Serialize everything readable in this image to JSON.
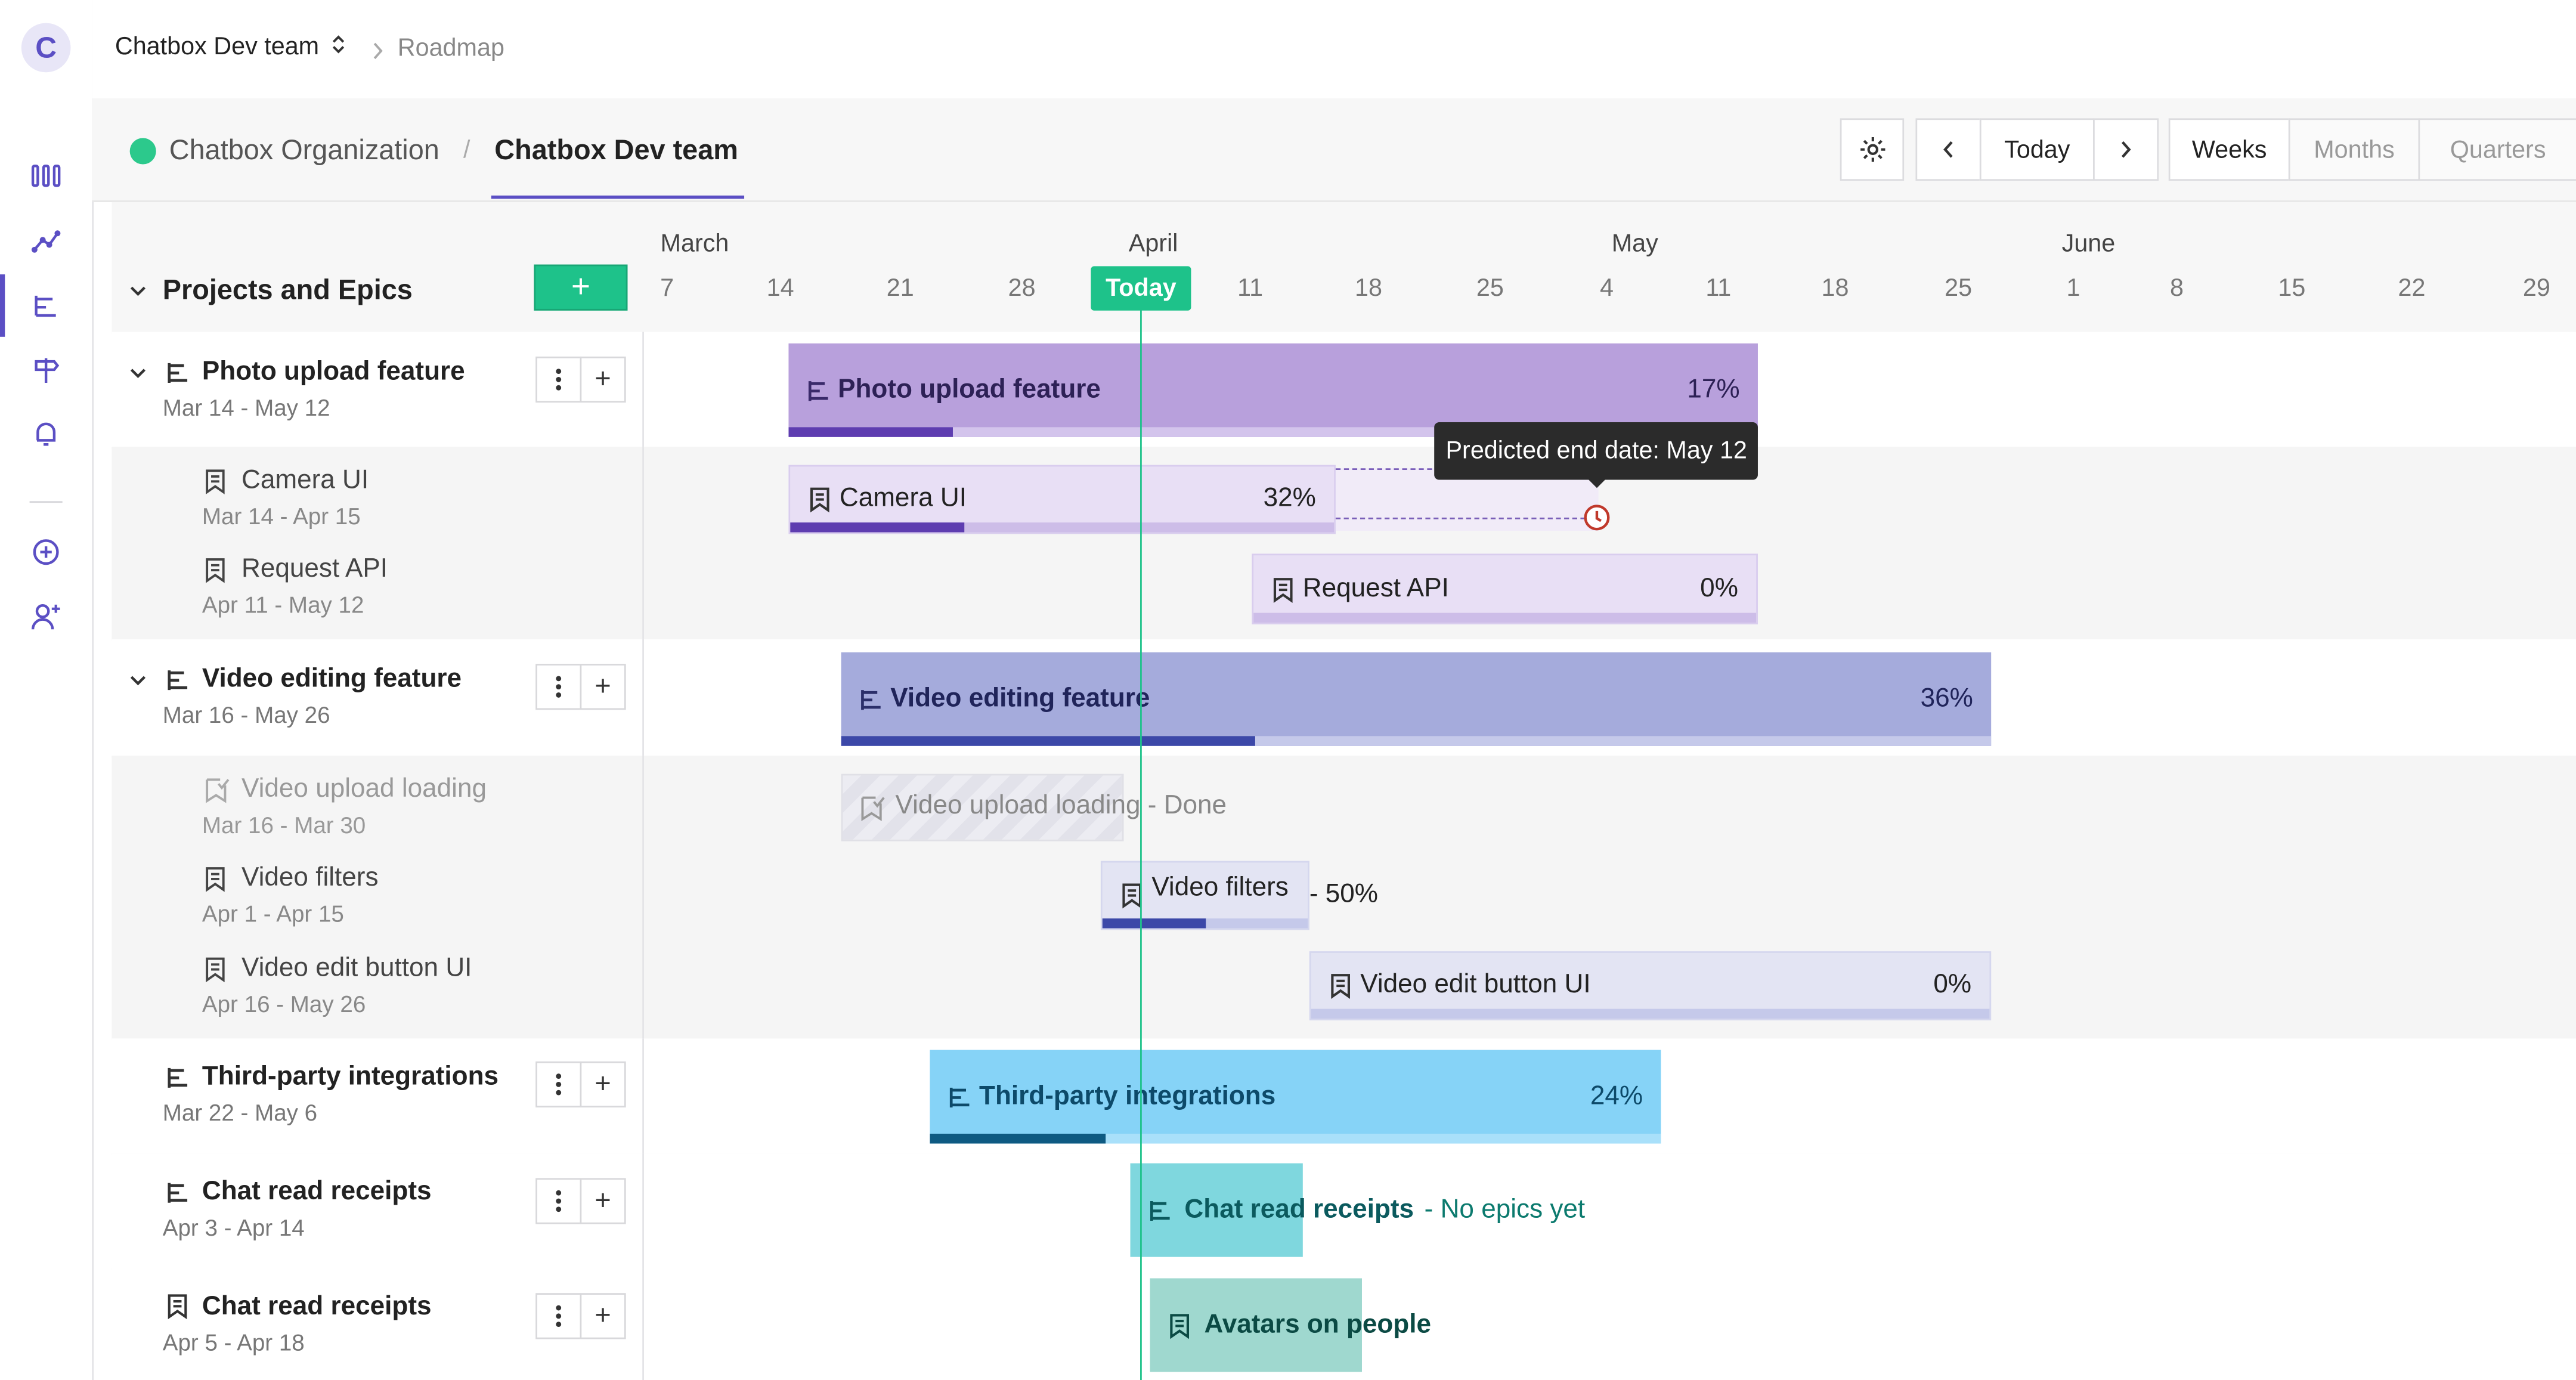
{
  "sidebar": {
    "logo": "C",
    "icons": [
      "columns-icon",
      "analytics-icon",
      "roadmap-icon",
      "signpost-icon",
      "bell-icon",
      "add-circle-icon",
      "add-user-icon"
    ]
  },
  "topbar": {
    "team": "Chatbox Dev team",
    "crumb": "Roadmap"
  },
  "subheader": {
    "org": "Chatbox Organization",
    "separator": "/",
    "team_tab": "Chatbox Dev team",
    "today": "Today",
    "views": [
      "Weeks",
      "Months",
      "Quarters"
    ],
    "active_view": "Weeks"
  },
  "timeline": {
    "title": "Projects and Epics",
    "add_label": "+",
    "today_label": "Today",
    "months": [
      "March",
      "April",
      "May",
      "June"
    ],
    "days": [
      "7",
      "14",
      "21",
      "28",
      "Today",
      "11",
      "18",
      "25",
      "4",
      "11",
      "18",
      "25",
      "1",
      "8",
      "15",
      "22",
      "29"
    ]
  },
  "colors": {
    "accent": "#5b4fc4",
    "today": "#1ec28a",
    "photo": "#b8a0dc",
    "video": "#a5abdc",
    "third_party": "#86d3f7",
    "chat": "#7fd7de",
    "avatars": "#9fd8cf"
  },
  "rows": {
    "photo": {
      "name": "Photo upload feature",
      "dates": "Mar 14 - May 12",
      "bar_label": "Photo upload feature",
      "pct": "17%",
      "progress": 0.17
    },
    "camera": {
      "name": "Camera UI",
      "dates": "Mar 14 - Apr 15",
      "bar_label": "Camera UI",
      "pct": "32%",
      "progress": 0.32
    },
    "request": {
      "name": "Request API",
      "dates": "Apr 11 - May 12",
      "bar_label": "Request API",
      "pct": "0%",
      "progress": 0
    },
    "video": {
      "name": "Video editing feature",
      "dates": "Mar 16 - May 26",
      "bar_label": "Video editing feature",
      "pct": "36%",
      "progress": 0.36
    },
    "video_upload": {
      "name": "Video upload loading",
      "dates": "Mar 16 - Mar 30",
      "bar_label": "Video upload loading - Done"
    },
    "video_filters": {
      "name": "Video filters",
      "dates": "Apr 1 - Apr 15",
      "bar_label": "Video filters",
      "pct_text": "- 50%",
      "progress": 0.5
    },
    "video_edit": {
      "name": "Video edit button UI",
      "dates": "Apr 16 - May 26",
      "bar_label": "Video edit button UI",
      "pct": "0%",
      "progress": 0
    },
    "third": {
      "name": "Third-party integrations",
      "dates": "Mar 22 - May 6",
      "bar_label": "Third-party integrations",
      "pct": "24%",
      "progress": 0.24
    },
    "chat": {
      "name": "Chat read receipts",
      "dates": "Apr 3 - Apr 14",
      "bar_label": "Chat read receipts",
      "suffix": "- No epics yet"
    },
    "chat2": {
      "name": "Chat read receipts",
      "dates": "Apr 5 - Apr 18",
      "bar_label": "Avatars on people"
    }
  },
  "tooltip": "Predicted end date: May 12"
}
